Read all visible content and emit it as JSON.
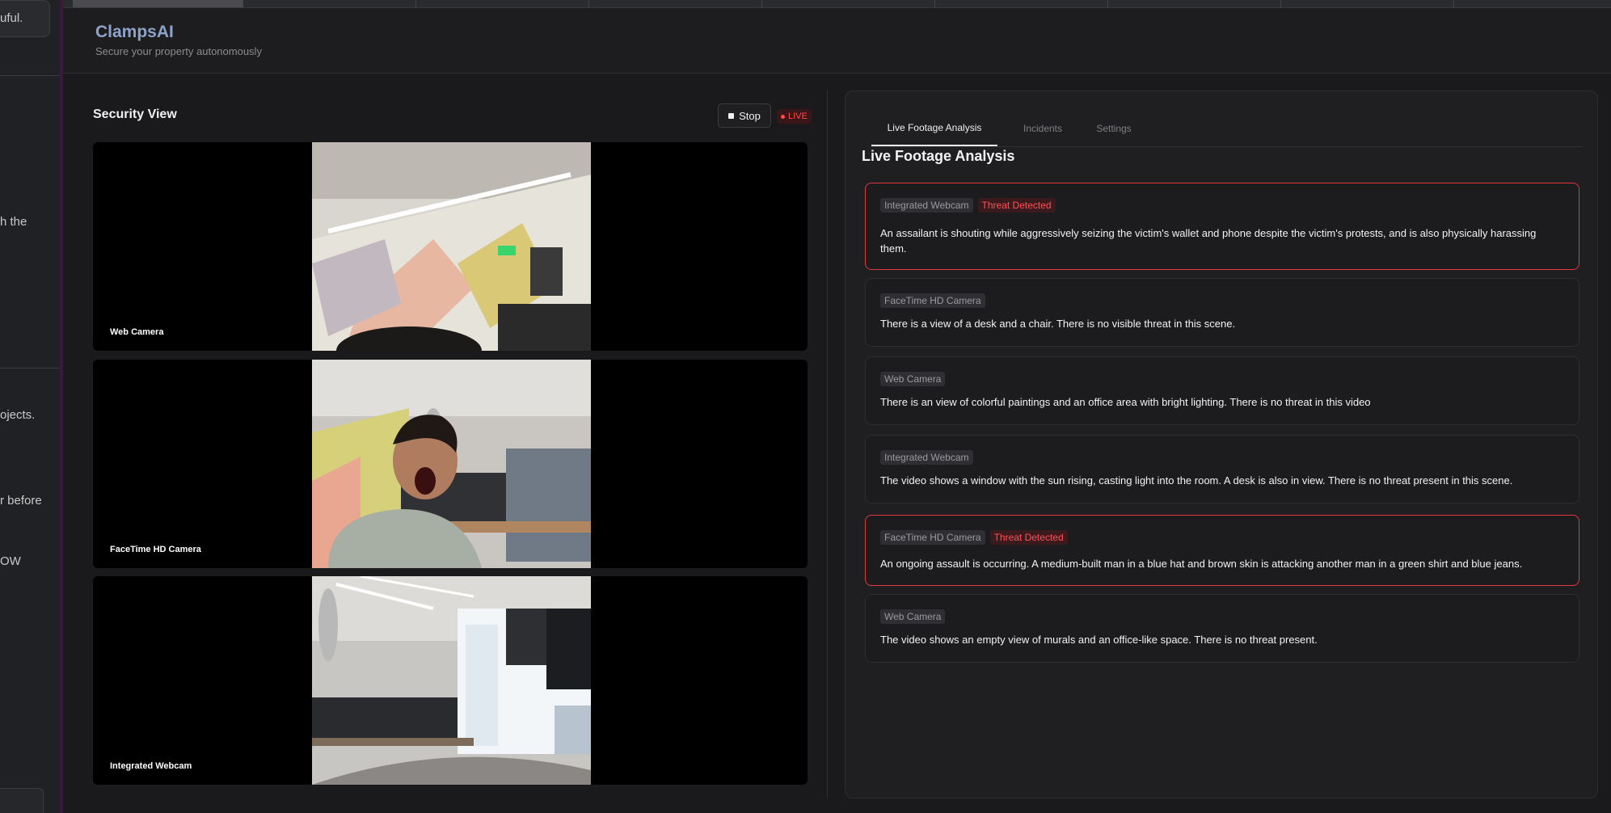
{
  "left_panel": {
    "fragments": [
      "uful.",
      "h the",
      "ojects.",
      "r before",
      "OW"
    ]
  },
  "header": {
    "brand": "ClampsAI",
    "tagline": "Secure your property autonomously"
  },
  "security_view": {
    "title": "Security View",
    "stop_label": "Stop",
    "live_label": "LIVE",
    "cameras": [
      {
        "label": "Web Camera",
        "icon": "camera-feed-office-ceiling"
      },
      {
        "label": "FaceTime HD Camera",
        "icon": "camera-feed-person-shouting"
      },
      {
        "label": "Integrated Webcam",
        "icon": "camera-feed-office-windows"
      }
    ]
  },
  "analysis": {
    "tabs": [
      "Live Footage Analysis",
      "Incidents",
      "Settings"
    ],
    "active_tab": "Live Footage Analysis",
    "title": "Live Footage Analysis",
    "threat_label": "Threat Detected",
    "entries": [
      {
        "source": "Integrated Webcam",
        "threat": true,
        "text": "An assailant is shouting while aggressively seizing the victim's wallet and phone despite the victim's protests, and is also physically harassing them."
      },
      {
        "source": "FaceTime HD Camera",
        "threat": false,
        "text": "There is a view of a desk and a chair. There is no visible threat in this scene."
      },
      {
        "source": "Web Camera",
        "threat": false,
        "text": "There is an view of colorful paintings and an office area with bright lighting. There is no threat in this video"
      },
      {
        "source": "Integrated Webcam",
        "threat": false,
        "text": "The video shows a window with the sun rising, casting light into the room. A desk is also in view. There is no threat present in this scene."
      },
      {
        "source": "FaceTime HD Camera",
        "threat": true,
        "text": "An ongoing assault is occurring. A medium-built man in a blue hat and brown skin is attacking another man in a green shirt and blue jeans."
      },
      {
        "source": "Web Camera",
        "threat": false,
        "text": "The video shows an empty view of murals and an office-like space. There is no threat present."
      }
    ]
  },
  "colors": {
    "accent_brand": "#8fa3c8",
    "threat_red": "#e2373f",
    "live_red": "#ff4b4b"
  }
}
